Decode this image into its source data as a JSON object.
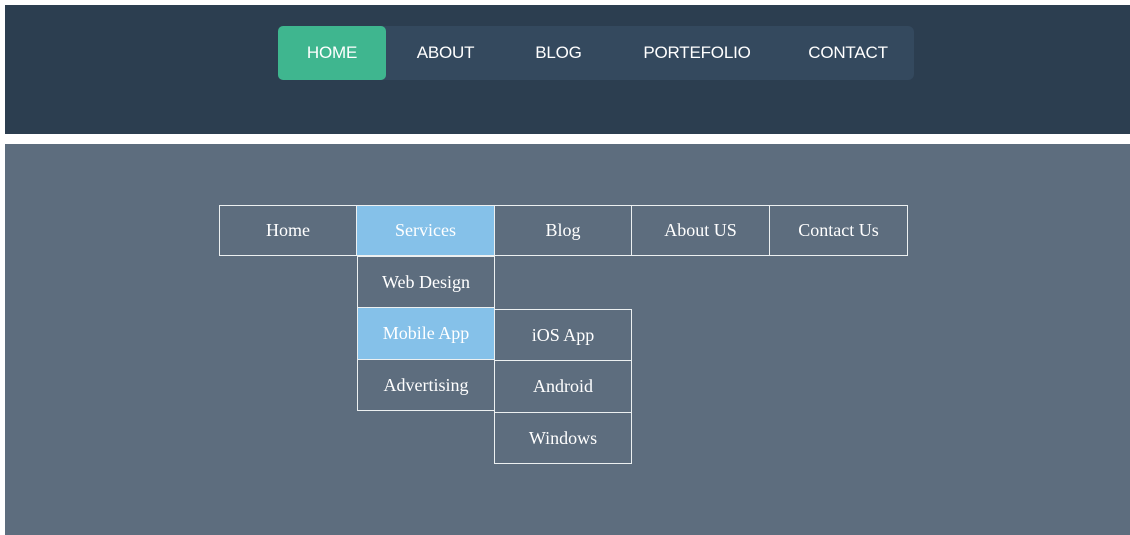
{
  "top_nav": {
    "items": [
      {
        "label": "HOME",
        "active": true
      },
      {
        "label": "ABOUT",
        "active": false
      },
      {
        "label": "BLOG",
        "active": false
      },
      {
        "label": "PORTEFOLIO",
        "active": false
      },
      {
        "label": "CONTACT",
        "active": false
      }
    ]
  },
  "dropdown_menu": {
    "main": [
      {
        "label": "Home",
        "highlighted": false
      },
      {
        "label": "Services",
        "highlighted": true
      },
      {
        "label": "Blog",
        "highlighted": false
      },
      {
        "label": "About US",
        "highlighted": false
      },
      {
        "label": "Contact Us",
        "highlighted": false
      }
    ],
    "services_submenu": [
      {
        "label": "Web Design",
        "highlighted": false
      },
      {
        "label": "Mobile App",
        "highlighted": true
      },
      {
        "label": "Advertising",
        "highlighted": false
      }
    ],
    "mobile_app_submenu": [
      {
        "label": "iOS App",
        "highlighted": false
      },
      {
        "label": "Android",
        "highlighted": false
      },
      {
        "label": "Windows",
        "highlighted": false
      }
    ]
  },
  "colors": {
    "top_background": "#2c3e50",
    "top_nav_bar": "#34495e",
    "active_accent": "#3fb68f",
    "bottom_background": "#5d6d7e",
    "highlight": "#85c1e9",
    "border": "#ecf0f1",
    "text": "#ffffff"
  }
}
